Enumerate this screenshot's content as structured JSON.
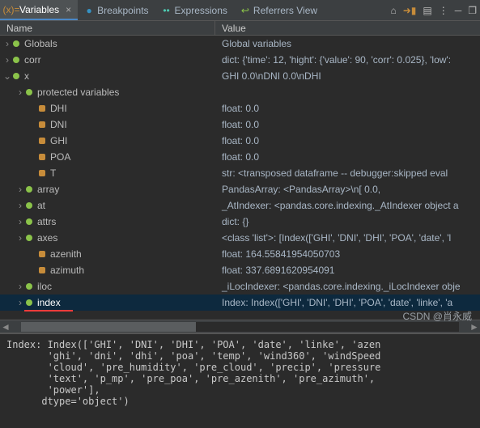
{
  "tabs": {
    "variables": "Variables",
    "breakpoints": "Breakpoints",
    "expressions": "Expressions",
    "referrers": "Referrers View"
  },
  "columns": {
    "name": "Name",
    "value": "Value"
  },
  "rows": [
    {
      "name": "Globals",
      "value": "Global variables"
    },
    {
      "name": "corr",
      "value": "dict: {'time': 12, 'hight': {'value': 90, 'corr': 0.025}, 'low':"
    },
    {
      "name": "x",
      "value": "GHI                  0.0\\nDNI                  0.0\\nDHI"
    },
    {
      "name": "protected variables",
      "value": ""
    },
    {
      "name": "DHI",
      "value": "float: 0.0"
    },
    {
      "name": "DNI",
      "value": "float: 0.0"
    },
    {
      "name": "GHI",
      "value": "float: 0.0"
    },
    {
      "name": "POA",
      "value": "float: 0.0"
    },
    {
      "name": "T",
      "value": "str: <transposed dataframe -- debugger:skipped eval"
    },
    {
      "name": "array",
      "value": "PandasArray: <PandasArray>\\n[               0.0,"
    },
    {
      "name": "at",
      "value": "_AtIndexer: <pandas.core.indexing._AtIndexer object a"
    },
    {
      "name": "attrs",
      "value": "dict: {}"
    },
    {
      "name": "axes",
      "value": "<class 'list'>: [Index(['GHI', 'DNI', 'DHI', 'POA', 'date', 'l"
    },
    {
      "name": "azenith",
      "value": "float: 164.55841954050703"
    },
    {
      "name": "azimuth",
      "value": "float: 337.6891620954091"
    },
    {
      "name": "iloc",
      "value": "_iLocIndexer: <pandas.core.indexing._iLocIndexer obje"
    },
    {
      "name": "index",
      "value": "Index: Index(['GHI', 'DNI', 'DHI', 'POA', 'date', 'linke', 'a"
    }
  ],
  "console_text": "Index: Index(['GHI', 'DNI', 'DHI', 'POA', 'date', 'linke', 'azen\n       'ghi', 'dni', 'dhi', 'poa', 'temp', 'wind360', 'windSpeed\n       'cloud', 'pre_humidity', 'pre_cloud', 'precip', 'pressure\n       'text', 'p_mp', 'pre_poa', 'pre_azenith', 'pre_azimuth',\n       'power'],\n      dtype='object')",
  "watermark": "CSDN @肖永威"
}
